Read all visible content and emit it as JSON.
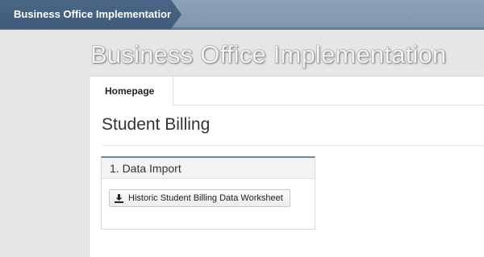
{
  "breadcrumb": {
    "current": "Business Office Implementation"
  },
  "header": {
    "title": "Business Office Implementation"
  },
  "tabs": [
    {
      "label": "Homepage"
    }
  ],
  "section": {
    "title": "Student Billing"
  },
  "card": {
    "title": "1. Data Import",
    "button_label": "Historic Student Billing Data Worksheet",
    "button_icon": "download-icon"
  }
}
